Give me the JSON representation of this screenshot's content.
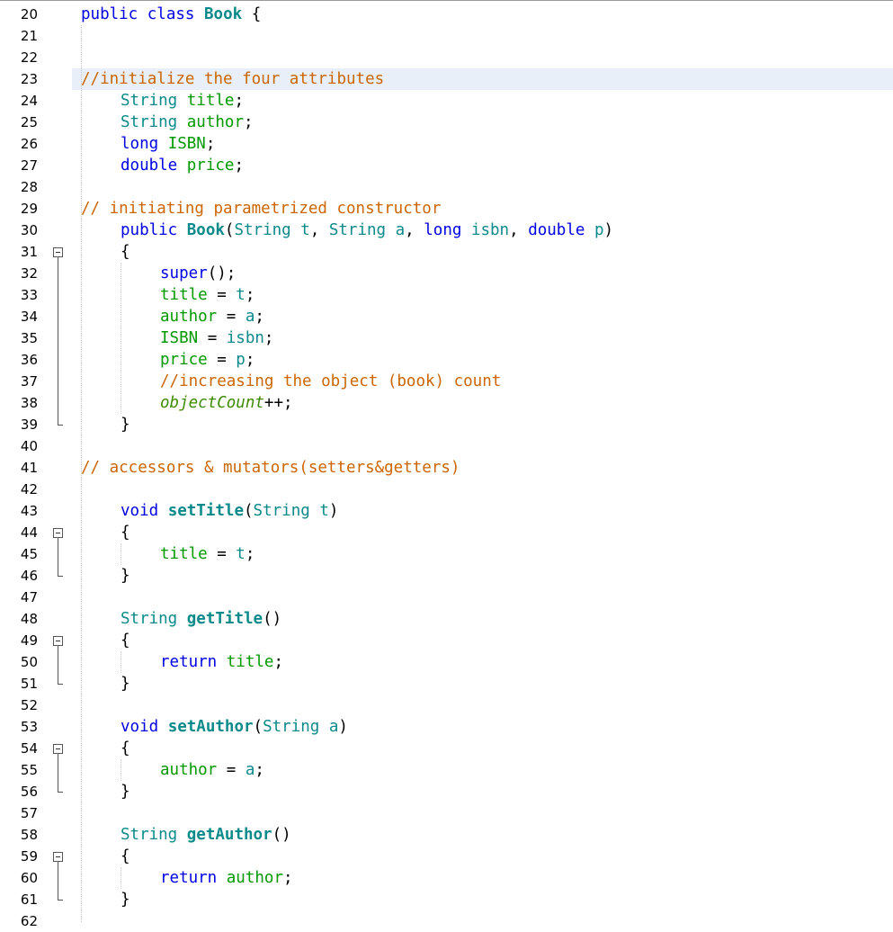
{
  "editor": {
    "lines": [
      {
        "n": "20",
        "tokens": [
          [
            "kw",
            "public"
          ],
          [
            "pl",
            " "
          ],
          [
            "kw",
            "class"
          ],
          [
            "pl",
            " "
          ],
          [
            "fn",
            "Book"
          ],
          [
            "pl",
            " {"
          ]
        ],
        "indent": 0
      },
      {
        "n": "21",
        "tokens": [],
        "indent": 0
      },
      {
        "n": "22",
        "tokens": [],
        "indent": 0
      },
      {
        "n": "23",
        "tokens": [
          [
            "cm",
            "//initialize the four attributes"
          ]
        ],
        "indent": 0,
        "highlight": true
      },
      {
        "n": "24",
        "tokens": [
          [
            "cls",
            "String"
          ],
          [
            "pl",
            " "
          ],
          [
            "fld",
            "title"
          ],
          [
            "pl",
            ";"
          ]
        ],
        "indent": 1
      },
      {
        "n": "25",
        "tokens": [
          [
            "cls",
            "String"
          ],
          [
            "pl",
            " "
          ],
          [
            "fld",
            "author"
          ],
          [
            "pl",
            ";"
          ]
        ],
        "indent": 1
      },
      {
        "n": "26",
        "tokens": [
          [
            "kw",
            "long"
          ],
          [
            "pl",
            " "
          ],
          [
            "fld",
            "ISBN"
          ],
          [
            "pl",
            ";"
          ]
        ],
        "indent": 1
      },
      {
        "n": "27",
        "tokens": [
          [
            "kw",
            "double"
          ],
          [
            "pl",
            " "
          ],
          [
            "fld",
            "price"
          ],
          [
            "pl",
            ";"
          ]
        ],
        "indent": 1
      },
      {
        "n": "28",
        "tokens": [],
        "indent": 0
      },
      {
        "n": "29",
        "tokens": [
          [
            "cm",
            "// initiating parametrized constructor"
          ]
        ],
        "indent": 0
      },
      {
        "n": "30",
        "tokens": [
          [
            "kw",
            "public"
          ],
          [
            "pl",
            " "
          ],
          [
            "fn",
            "Book"
          ],
          [
            "pl",
            "("
          ],
          [
            "cls",
            "String"
          ],
          [
            "pl",
            " "
          ],
          [
            "cls",
            "t"
          ],
          [
            "pl",
            ", "
          ],
          [
            "cls",
            "String"
          ],
          [
            "pl",
            " "
          ],
          [
            "cls",
            "a"
          ],
          [
            "pl",
            ", "
          ],
          [
            "kw",
            "long"
          ],
          [
            "pl",
            " "
          ],
          [
            "cls",
            "isbn"
          ],
          [
            "pl",
            ", "
          ],
          [
            "kw",
            "double"
          ],
          [
            "pl",
            " "
          ],
          [
            "cls",
            "p"
          ],
          [
            "pl",
            ")"
          ]
        ],
        "indent": 1
      },
      {
        "n": "31",
        "tokens": [
          [
            "pl",
            "{"
          ]
        ],
        "indent": 1
      },
      {
        "n": "32",
        "tokens": [
          [
            "kw",
            "super"
          ],
          [
            "pl",
            "();"
          ]
        ],
        "indent": 2
      },
      {
        "n": "33",
        "tokens": [
          [
            "fld",
            "title"
          ],
          [
            "pl",
            " = "
          ],
          [
            "cls",
            "t"
          ],
          [
            "pl",
            ";"
          ]
        ],
        "indent": 2
      },
      {
        "n": "34",
        "tokens": [
          [
            "fld",
            "author"
          ],
          [
            "pl",
            " = "
          ],
          [
            "cls",
            "a"
          ],
          [
            "pl",
            ";"
          ]
        ],
        "indent": 2
      },
      {
        "n": "35",
        "tokens": [
          [
            "fld",
            "ISBN"
          ],
          [
            "pl",
            " = "
          ],
          [
            "cls",
            "isbn"
          ],
          [
            "pl",
            ";"
          ]
        ],
        "indent": 2
      },
      {
        "n": "36",
        "tokens": [
          [
            "fld",
            "price"
          ],
          [
            "pl",
            " = "
          ],
          [
            "cls",
            "p"
          ],
          [
            "pl",
            ";"
          ]
        ],
        "indent": 2
      },
      {
        "n": "37",
        "tokens": [
          [
            "cm",
            "//increasing the object (book) count"
          ]
        ],
        "indent": 2
      },
      {
        "n": "38",
        "tokens": [
          [
            "it",
            "objectCount"
          ],
          [
            "pl",
            "++;"
          ]
        ],
        "indent": 2
      },
      {
        "n": "39",
        "tokens": [
          [
            "pl",
            "}"
          ]
        ],
        "indent": 1
      },
      {
        "n": "40",
        "tokens": [],
        "indent": 0
      },
      {
        "n": "41",
        "tokens": [
          [
            "cm",
            "// accessors & mutators(setters&getters)"
          ]
        ],
        "indent": 0
      },
      {
        "n": "42",
        "tokens": [],
        "indent": 0
      },
      {
        "n": "43",
        "tokens": [
          [
            "kw",
            "void"
          ],
          [
            "pl",
            " "
          ],
          [
            "fn",
            "setTitle"
          ],
          [
            "pl",
            "("
          ],
          [
            "cls",
            "String"
          ],
          [
            "pl",
            " "
          ],
          [
            "cls",
            "t"
          ],
          [
            "pl",
            ")"
          ]
        ],
        "indent": 1
      },
      {
        "n": "44",
        "tokens": [
          [
            "pl",
            "{"
          ]
        ],
        "indent": 1
      },
      {
        "n": "45",
        "tokens": [
          [
            "fld",
            "title"
          ],
          [
            "pl",
            " = "
          ],
          [
            "cls",
            "t"
          ],
          [
            "pl",
            ";"
          ]
        ],
        "indent": 2
      },
      {
        "n": "46",
        "tokens": [
          [
            "pl",
            "}"
          ]
        ],
        "indent": 1
      },
      {
        "n": "47",
        "tokens": [],
        "indent": 0
      },
      {
        "n": "48",
        "tokens": [
          [
            "cls",
            "String"
          ],
          [
            "pl",
            " "
          ],
          [
            "fn",
            "getTitle"
          ],
          [
            "pl",
            "()"
          ]
        ],
        "indent": 1
      },
      {
        "n": "49",
        "tokens": [
          [
            "pl",
            "{"
          ]
        ],
        "indent": 1
      },
      {
        "n": "50",
        "tokens": [
          [
            "kw",
            "return"
          ],
          [
            "pl",
            " "
          ],
          [
            "fld",
            "title"
          ],
          [
            "pl",
            ";"
          ]
        ],
        "indent": 2
      },
      {
        "n": "51",
        "tokens": [
          [
            "pl",
            "}"
          ]
        ],
        "indent": 1
      },
      {
        "n": "52",
        "tokens": [],
        "indent": 0
      },
      {
        "n": "53",
        "tokens": [
          [
            "kw",
            "void"
          ],
          [
            "pl",
            " "
          ],
          [
            "fn",
            "setAuthor"
          ],
          [
            "pl",
            "("
          ],
          [
            "cls",
            "String"
          ],
          [
            "pl",
            " "
          ],
          [
            "cls",
            "a"
          ],
          [
            "pl",
            ")"
          ]
        ],
        "indent": 1
      },
      {
        "n": "54",
        "tokens": [
          [
            "pl",
            "{"
          ]
        ],
        "indent": 1
      },
      {
        "n": "55",
        "tokens": [
          [
            "fld",
            "author"
          ],
          [
            "pl",
            " = "
          ],
          [
            "cls",
            "a"
          ],
          [
            "pl",
            ";"
          ]
        ],
        "indent": 2
      },
      {
        "n": "56",
        "tokens": [
          [
            "pl",
            "}"
          ]
        ],
        "indent": 1
      },
      {
        "n": "57",
        "tokens": [],
        "indent": 0
      },
      {
        "n": "58",
        "tokens": [
          [
            "cls",
            "String"
          ],
          [
            "pl",
            " "
          ],
          [
            "fn",
            "getAuthor"
          ],
          [
            "pl",
            "()"
          ]
        ],
        "indent": 1
      },
      {
        "n": "59",
        "tokens": [
          [
            "pl",
            "{"
          ]
        ],
        "indent": 1
      },
      {
        "n": "60",
        "tokens": [
          [
            "kw",
            "return"
          ],
          [
            "pl",
            " "
          ],
          [
            "fld",
            "author"
          ],
          [
            "pl",
            ";"
          ]
        ],
        "indent": 2
      },
      {
        "n": "61",
        "tokens": [
          [
            "pl",
            "}"
          ]
        ],
        "indent": 1
      },
      {
        "n": "62",
        "tokens": [],
        "indent": 0
      }
    ],
    "folds": [
      {
        "start": "31",
        "end": "39"
      },
      {
        "start": "44",
        "end": "46"
      },
      {
        "start": "49",
        "end": "51"
      },
      {
        "start": "54",
        "end": "56"
      },
      {
        "start": "59",
        "end": "61"
      }
    ],
    "colors": {
      "keyword": "#0000e6",
      "type": "#0a8a8a",
      "field": "#009900",
      "comment": "#cc6600",
      "highlight": "#e9eff8"
    }
  }
}
